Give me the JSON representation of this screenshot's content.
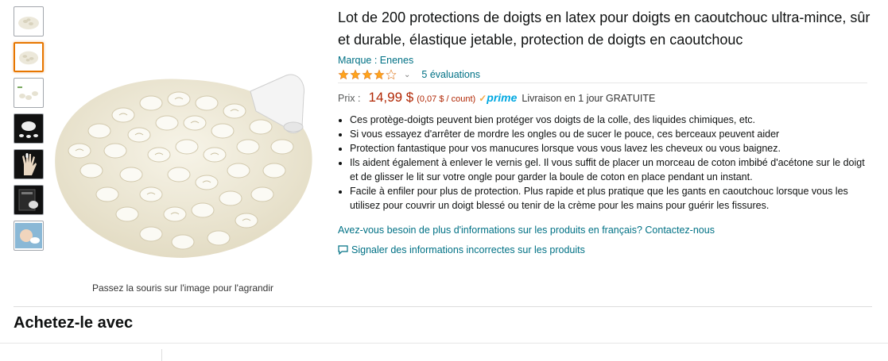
{
  "gallery": {
    "thumbnails": [
      {
        "name": "thumb-1",
        "active": false
      },
      {
        "name": "thumb-2",
        "active": true
      },
      {
        "name": "thumb-3",
        "active": false
      },
      {
        "name": "thumb-4",
        "active": false
      },
      {
        "name": "thumb-5",
        "active": false
      },
      {
        "name": "thumb-6",
        "active": false
      },
      {
        "name": "thumb-7",
        "active": false
      }
    ],
    "zoom_hint": "Passez la souris sur l'image pour l'agrandir"
  },
  "product": {
    "title": "Lot de 200 protections de doigts en latex pour doigts en caoutchouc ultra-mince, sûr et durable, élastique jetable, protection de doigts en caoutchouc",
    "brand": "Marque : Enenes",
    "rating_stars": 4,
    "ratings_text": "5 évaluations",
    "price_label": "Prix :",
    "price": "14,99 $",
    "unit_price": "(0,07 $ / count)",
    "prime_label": "prime",
    "delivery": "Livraison en 1 jour GRATUITE",
    "bullets": [
      "Ces protège-doigts peuvent bien protéger vos doigts de la colle, des liquides chimiques, etc.",
      "Si vous essayez d'arrêter de mordre les ongles ou de sucer le pouce, ces berceaux peuvent aider",
      "Protection fantastique pour vos manucures lorsque vous vous lavez les cheveux ou vous baignez.",
      "Ils aident également à enlever le vernis gel. Il vous suffit de placer un morceau de coton imbibé d'acétone sur le doigt et de glisser le lit sur votre ongle pour garder la boule de coton en place pendant un instant.",
      "Facile à enfiler pour plus de protection. Plus rapide et plus pratique que les gants en caoutchouc lorsque vous les utilisez pour couvrir un doigt blessé ou tenir de la crème pour les mains pour guérir les fissures."
    ],
    "more_info_link": "Avez-vous besoin de plus d'informations sur les produits en français? Contactez-nous",
    "report_link": "Signaler des informations incorrectes sur les produits"
  },
  "sections": {
    "buy_together_title": "Achetez-le avec"
  },
  "colors": {
    "link": "#007185",
    "price": "#b12704",
    "star": "#ffa41c",
    "prime": "#00a8e1",
    "active_thumb": "#e77600"
  }
}
